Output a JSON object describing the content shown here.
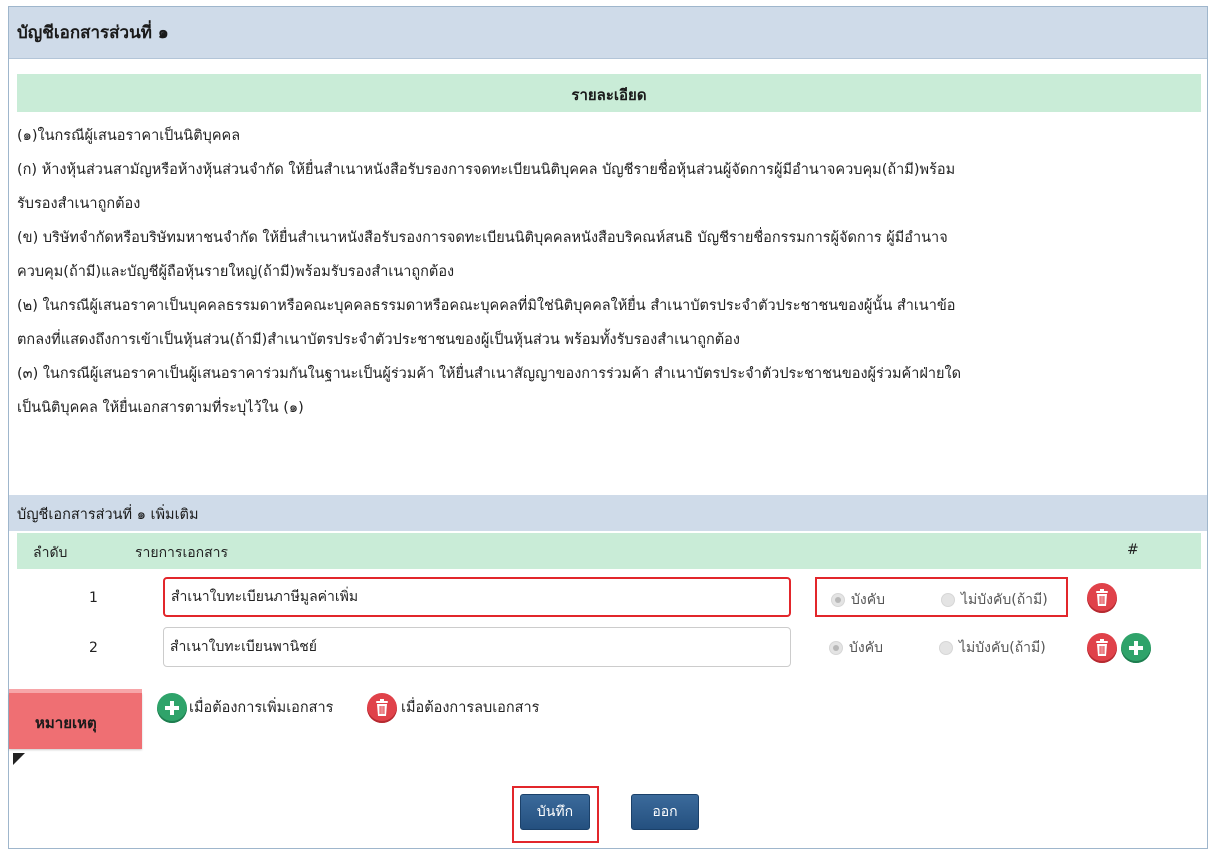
{
  "section_title": "บัญชีเอกสารส่วนที่ ๑",
  "detail": {
    "header": "รายละเอียด",
    "paragraphs": [
      "(๑)ในกรณีผู้เสนอราคาเป็นนิติบุคคล",
      "(ก) ห้างหุ้นส่วนสามัญหรือห้างหุ้นส่วนจำกัด ให้ยื่นสำเนาหนังสือรับรองการจดทะเบียนนิติบุคคล บัญชีรายชื่อหุ้นส่วนผู้จัดการผู้มีอำนาจควบคุม(ถ้ามี)พร้อม",
      "รับรองสำเนาถูกต้อง",
      "(ข) บริษัทจำกัดหรือบริษัทมหาชนจำกัด ให้ยื่นสำเนาหนังสือรับรองการจดทะเบียนนิติบุคคลหนังสือบริคณห์สนธิ บัญชีรายชื่อกรรมการผู้จัดการ ผู้มีอำนาจ",
      "ควบคุม(ถ้ามี)และบัญชีผู้ถือหุ้นรายใหญ่(ถ้ามี)พร้อมรับรองสำเนาถูกต้อง",
      "(๒) ในกรณีผู้เสนอราคาเป็นบุคคลธรรมดาหรือคณะบุคคลธรรมดาหรือคณะบุคคลที่มิใช่นิติบุคคลให้ยื่น สำเนาบัตรประจำตัวประชาชนของผู้นั้น สำเนาข้อ",
      "ตกลงที่แสดงถึงการเข้าเป็นหุ้นส่วน(ถ้ามี)สำเนาบัตรประจำตัวประชาชนของผู้เป็นหุ้นส่วน พร้อมทั้งรับรองสำเนาถูกต้อง",
      "(๓) ในกรณีผู้เสนอราคาเป็นผู้เสนอราคาร่วมกันในฐานะเป็นผู้ร่วมค้า ให้ยื่นสำเนาสัญญาของการร่วมค้า สำเนาบัตรประจำตัวประชาชนของผู้ร่วมค้าฝ่ายใด",
      "เป็นนิติบุคคล ให้ยื่นเอกสารตามที่ระบุไว้ใน (๑)"
    ]
  },
  "additional": {
    "title": "บัญชีเอกสารส่วนที่ ๑ เพิ่มเติม",
    "columns": {
      "order": "ลำดับ",
      "document": "รายการเอกสาร",
      "action": "#"
    },
    "rows": [
      {
        "num": "1",
        "value": "สำเนาใบทะเบียนภาษีมูลค่าเพิ่ม",
        "required_label": "บังคับ",
        "optional_label": "ไม่บังคับ(ถ้ามี)"
      },
      {
        "num": "2",
        "value": "สำเนาใบทะเบียนพานิชย์",
        "required_label": "บังคับ",
        "optional_label": "ไม่บังคับ(ถ้ามี)"
      }
    ]
  },
  "note": {
    "tab_label": "หมายเหตุ",
    "add_text": "เมื่อต้องการเพิ่มเอกสาร",
    "delete_text": "เมื่อต้องการลบเอกสาร"
  },
  "buttons": {
    "save": "บันทึก",
    "exit": "ออก"
  },
  "colors": {
    "highlight": "#e2262b",
    "header_blue": "#cfdbe9",
    "header_green": "#c9ecd7",
    "button": "#24507f"
  }
}
